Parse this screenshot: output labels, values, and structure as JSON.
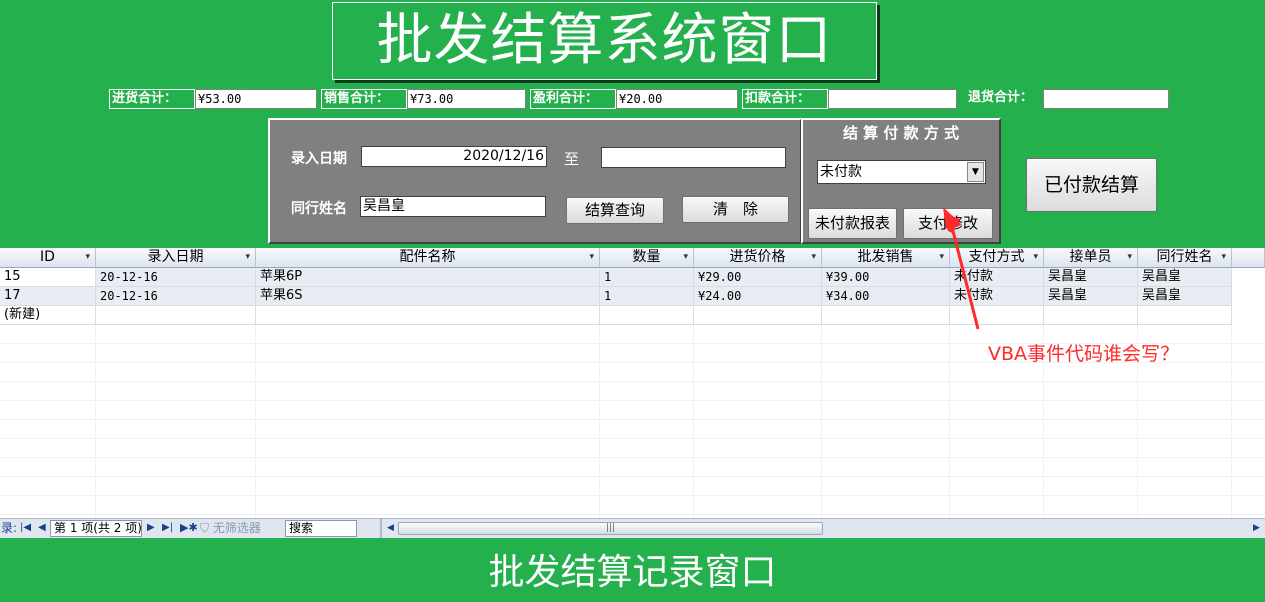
{
  "header": {
    "title": "批发结算系统窗口"
  },
  "summary": {
    "purchase_label": "进货合计：",
    "purchase_value": "¥53.00",
    "sales_label": "销售合计：",
    "sales_value": "¥73.00",
    "profit_label": "盈利合计：",
    "profit_value": "¥20.00",
    "deduct_label": "扣款合计：",
    "deduct_value": "",
    "return_label": "退货合计：",
    "return_value": ""
  },
  "filter": {
    "date_label": "录入日期",
    "date_from": "2020/12/16",
    "to_label": "至",
    "date_to": "",
    "name_label": "同行姓名",
    "name_value": "吴昌皇",
    "query_button": "结算查询",
    "clear_button": "清　除"
  },
  "payment": {
    "title": "结 算 付 款 方 式",
    "method_value": "未付款",
    "unpaid_report_button": "未付款报表",
    "modify_button": "支付修改"
  },
  "paid_settle_button": "已付款结算",
  "table": {
    "columns": [
      "ID",
      "录入日期",
      "配件名称",
      "数量",
      "进货价格",
      "批发销售",
      "支付方式",
      "接单员",
      "同行姓名"
    ],
    "rows": [
      [
        "15",
        "20-12-16",
        "苹果6P",
        "1",
        "¥29.00",
        "¥39.00",
        "未付款",
        "吴昌皇",
        "吴昌皇"
      ],
      [
        "17",
        "20-12-16",
        "苹果6S",
        "1",
        "¥24.00",
        "¥34.00",
        "未付款",
        "吴昌皇",
        "吴昌皇"
      ]
    ],
    "new_row": "(新建)"
  },
  "navbar": {
    "record_label": "录:",
    "record_position": "第 1 项(共 2 项)",
    "no_filter": "无筛选器",
    "search_placeholder": "搜索"
  },
  "footer_title": "批发结算记录窗口",
  "annotation": {
    "text": "VBA事件代码谁会写？",
    "color": "#ff2a2a"
  }
}
